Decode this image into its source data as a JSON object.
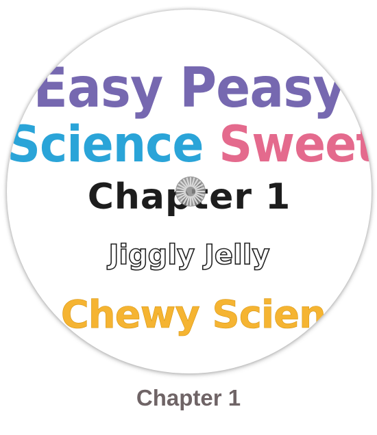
{
  "thumbnail": {
    "title_line1": "Easy Peasy",
    "title_line2_a": "Science",
    "title_line2_b": "Sweety",
    "chapter": "Chapter 1",
    "subtitle": "Jiggly Jelly",
    "tagline": "A Chewy Science",
    "colors": {
      "purple": "#7668b0",
      "blue": "#2aa4d8",
      "pink": "#e46a8d",
      "orange": "#f5b432"
    }
  },
  "loading_indicator": {
    "icon": "loading-spinner-icon"
  },
  "caption": "Chapter 1"
}
